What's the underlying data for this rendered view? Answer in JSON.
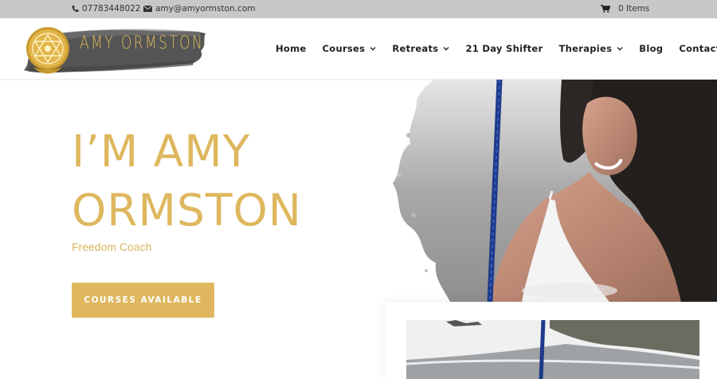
{
  "topbar": {
    "phone": "07783448022",
    "email": "amy@amyormston.com",
    "cart": "0 Items"
  },
  "logo": {
    "text": "AMY ORMSTON"
  },
  "nav": {
    "items": [
      {
        "label": "Home",
        "dropdown": false
      },
      {
        "label": "Courses",
        "dropdown": true
      },
      {
        "label": "Retreats",
        "dropdown": true
      },
      {
        "label": "21 Day Shifter",
        "dropdown": false
      },
      {
        "label": "Therapies",
        "dropdown": true
      },
      {
        "label": "Blog",
        "dropdown": false
      },
      {
        "label": "Contact Me",
        "dropdown": true
      }
    ]
  },
  "hero": {
    "title_line1": "I’M AMY",
    "title_line2": "ORMSTON",
    "subtitle": "Freedom Coach",
    "cta_label": "COURSES AVAILABLE"
  },
  "colors": {
    "accent": "#deb75e",
    "topbar_bg": "#c8c8c8",
    "text_dark": "#222222"
  },
  "icons": {
    "phone": "phone-icon",
    "email": "envelope-icon",
    "cart": "cart-icon",
    "dropdown": "chevron-down-icon"
  }
}
